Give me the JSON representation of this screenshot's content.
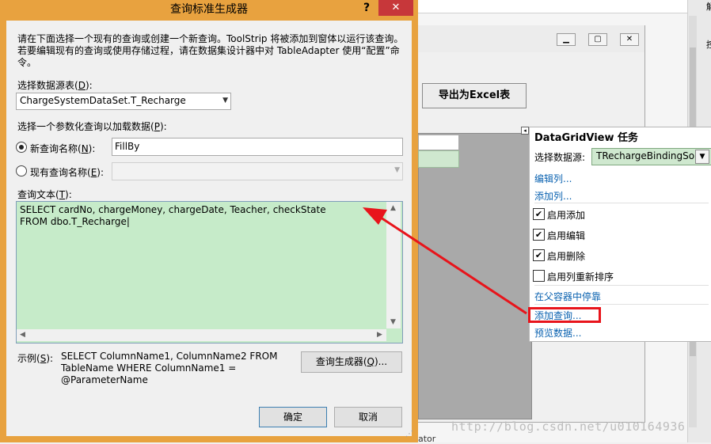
{
  "dialog": {
    "title": "查询标准生成器",
    "help_label": "?",
    "close_label": "✕",
    "description": "请在下面选择一个现有的查询或创建一个新查询。ToolStrip 将被添加到窗体以运行该查询。若要编辑现有的查询或使用存储过程，请在数据集设计器中对 TableAdapter 使用“配置”命令。",
    "table_label_pre": "选择数据源表(",
    "table_label_key": "D",
    "table_label_post": "):",
    "table_value": "ChargeSystemDataSet.T_Recharge",
    "param_label_pre": "选择一个参数化查询以加载数据(",
    "param_label_key": "P",
    "param_label_post": "):",
    "new_query_label_pre": "新查询名称(",
    "new_query_label_key": "N",
    "new_query_label_post": "):",
    "new_query_value": "FillBy",
    "existing_query_label_pre": "现有查询名称(",
    "existing_query_label_key": "E",
    "existing_query_label_post": "):",
    "query_text_label_pre": "查询文本(",
    "query_text_label_key": "T",
    "query_text_label_post": "):",
    "query_text_line1": "SELECT cardNo, chargeMoney, chargeDate, Teacher, checkState",
    "query_text_line2": "FROM dbo.T_Recharge",
    "example_label_pre": "示例(",
    "example_label_key": "S",
    "example_label_post": "):",
    "example_text": "SELECT ColumnName1, ColumnName2 FROM TableName WHERE ColumnName1 = @ParameterName",
    "query_builder_pre": "查询生成器(",
    "query_builder_key": "Q",
    "query_builder_post": ")...",
    "ok_label": "确定",
    "cancel_label": "取消",
    "new_query_selected": true
  },
  "background": {
    "excel_button": "导出为Excel表",
    "footer_fragment": "ator",
    "watermark": "http://blog.csdn.net/u010164936",
    "panel_char_top": "解",
    "panel_char_2": "控"
  },
  "tasks_panel": {
    "title": "DataGridView 任务",
    "data_source_label": "选择数据源:",
    "data_source_value": "TRechargeBindingSo",
    "edit_columns": "编辑列...",
    "add_column": "添加列...",
    "checkboxes": [
      {
        "label": "启用添加",
        "checked": true
      },
      {
        "label": "启用编辑",
        "checked": true
      },
      {
        "label": "启用删除",
        "checked": true
      },
      {
        "label": "启用列重新排序",
        "checked": false
      }
    ],
    "dock_in_parent": "在父容器中停靠",
    "add_query": "添加查询...",
    "preview_data": "预览数据..."
  },
  "colors": {
    "title_bar": "#e8a23f",
    "close_button": "#c7373a",
    "query_bg": "#c6ebc9",
    "link": "#0a62b0",
    "highlight": "#e8141b"
  }
}
